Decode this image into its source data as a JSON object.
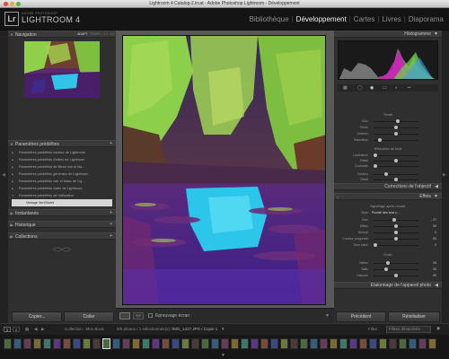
{
  "window": {
    "title": "Lightroom 4 Catalog-2.lrcat - Adobe Photoshop Lightroom - Développement"
  },
  "brand": {
    "badge": "Lr",
    "sub": "ADOBE PHOTOSHOP",
    "name": "LIGHTROOM 4"
  },
  "modules": {
    "items": [
      "Bibliothèque",
      "Développement",
      "Cartes",
      "Livres",
      "Diaporama"
    ],
    "active": "Développement"
  },
  "left_panel": {
    "navigator": {
      "title": "Navigation",
      "zoom_options": [
        "ADAPT.",
        "REMPL.",
        "1:1",
        "1:3"
      ]
    },
    "presets": {
      "title": "Paramètres prédéfinis",
      "items": [
        "Paramètres prédéfinis couleur de Lightroom",
        "Paramètres prédéfinis d'effets de Lightroom",
        "Paramètres prédéfinis de filtres noir et bla...",
        "Paramètres prédéfinis généraux de Lightroom",
        "Paramètres prédéfinis noir et blanc de Lig...",
        "Paramètres prédéfinis vidéo de Lightroom",
        "Paramètres prédéfinis de l'utilisateur"
      ],
      "selected": "Vintage Vert/Violet"
    },
    "sections": [
      "Instantanés",
      "Historique",
      "Collections"
    ],
    "buttons": {
      "copy": "Copier...",
      "paste": "Coller"
    }
  },
  "toolbar": {
    "proof_label": "Epreuvage écran"
  },
  "right_panel": {
    "histogram_title": "Histogramme",
    "split_toning": {
      "title": "Teinte",
      "rows": [
        {
          "label": "Gain",
          "pos": 0.55
        },
        {
          "label": "Teinte",
          "pos": 0.5
        },
        {
          "label": "Ombres",
          "pos": 0.5
        },
        {
          "label": "Saturation",
          "pos": 0.1
        }
      ]
    },
    "noise": {
      "title": "Réduction du bruit",
      "rows": [
        {
          "label": "Luminance",
          "pos": 0.0
        },
        {
          "label": "Détail",
          "pos": 0.5
        },
        {
          "label": "Contraste",
          "pos": 0.0
        },
        {
          "label": "Couleur",
          "pos": 0.25
        },
        {
          "label": "Détail",
          "pos": 0.5
        }
      ]
    },
    "lens_title": "Corrections de l'objectif",
    "effects": {
      "title": "Effets",
      "vignette_title": "Vignetage après recadr.",
      "style_label": "Style:",
      "style_value": "Priorité des tons c...",
      "rows": [
        {
          "label": "Gain",
          "pos": 0.45,
          "value": "- 27"
        },
        {
          "label": "Milieu",
          "pos": 0.5,
          "value": "50"
        },
        {
          "label": "Arrondi",
          "pos": 0.5,
          "value": "0"
        },
        {
          "label": "Contour progressif",
          "pos": 0.5,
          "value": "50"
        },
        {
          "label": "Tons clairs",
          "pos": 0.0,
          "value": "0"
        }
      ],
      "grain_title": "Grain",
      "grain_rows": [
        {
          "label": "Valeur",
          "pos": 0.3,
          "value": "28"
        },
        {
          "label": "Taille",
          "pos": 0.25,
          "value": "25"
        },
        {
          "label": "Cassure",
          "pos": 0.5,
          "value": "50"
        }
      ]
    },
    "calibration_title": "Etalonnage de l'appareil photo",
    "buttons": {
      "previous": "Précédent",
      "reset": "Réinitialiser"
    }
  },
  "filmstrip": {
    "pages": [
      "1",
      "2"
    ],
    "collection": "Collection : Mon Book",
    "count": "9/0 photos / 1 sélectionnée(s) /",
    "filename": "IMG_1417.JPG / Copie 1",
    "filter_label": "Filtre :",
    "filter_value": "Filtres désactivés"
  },
  "colors": {
    "accent_purple": "#7a2fa0",
    "accent_green": "#8fd24a",
    "panel": "#2f2f2f",
    "header": "#141414"
  }
}
